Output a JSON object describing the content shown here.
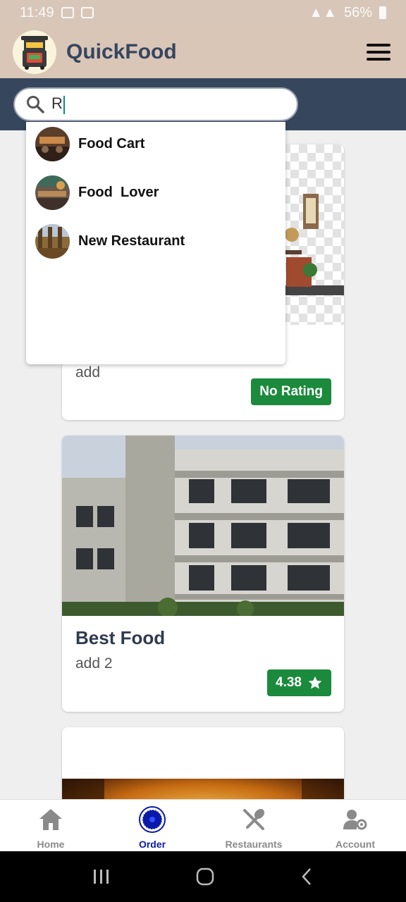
{
  "status_bar": {
    "time": "11:49",
    "battery": "56%"
  },
  "header": {
    "app_title": "QuickFood"
  },
  "search": {
    "value": "R",
    "placeholder": ""
  },
  "suggestions": [
    {
      "label": "Food Cart"
    },
    {
      "label": "Food  Lover"
    },
    {
      "label": "New Restaurant"
    }
  ],
  "cards": [
    {
      "title": "",
      "address": "add",
      "rating": "No Rating",
      "show_star": false
    },
    {
      "title": "Best Food",
      "address": "add 2",
      "rating": "4.38",
      "show_star": true
    },
    {
      "title": "",
      "address": "",
      "rating": "",
      "show_star": false
    }
  ],
  "bottom_nav": [
    {
      "label": "Home",
      "icon": "home-icon",
      "active": false
    },
    {
      "label": "Order",
      "icon": "order-icon",
      "active": true
    },
    {
      "label": "Restaurants",
      "icon": "restaurants-icon",
      "active": false
    },
    {
      "label": "Account",
      "icon": "account-settings-icon",
      "active": false
    }
  ],
  "colors": {
    "header_bg": "#d9c6b7",
    "search_band_bg": "#36465c",
    "title_text": "#37455f",
    "rating_green": "#1b8a3c",
    "nav_active": "#0a1aa8",
    "nav_inactive": "#8a8a8a"
  }
}
